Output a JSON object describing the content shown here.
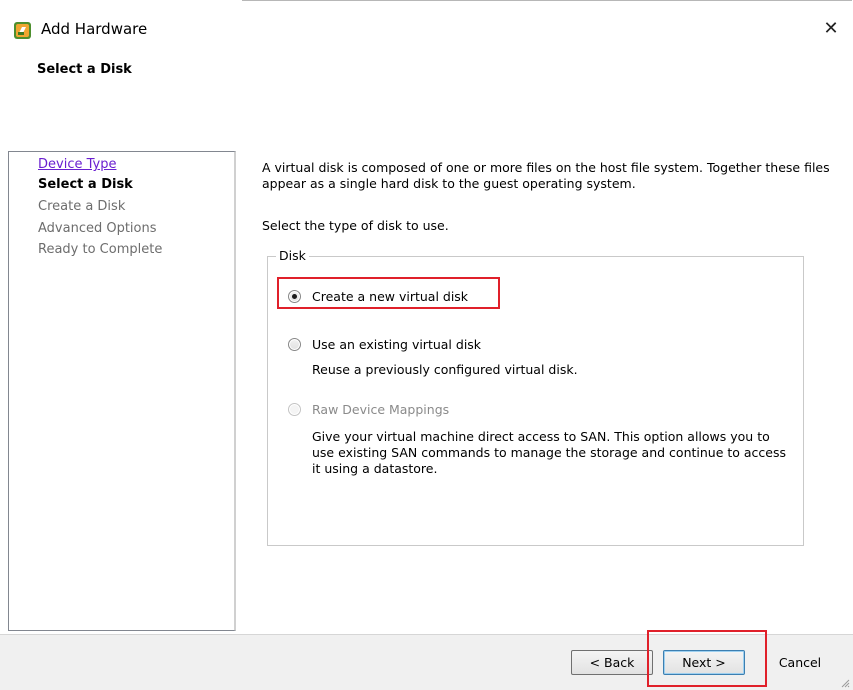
{
  "window": {
    "title": "Add Hardware",
    "close_symbol": "✕",
    "subtitle": "Select a Disk"
  },
  "nav": {
    "items": [
      {
        "label": "Device Type",
        "state": "link"
      },
      {
        "label": "Select a Disk",
        "state": "current"
      },
      {
        "label": "Create a Disk",
        "state": "disabled"
      },
      {
        "label": "Advanced Options",
        "state": "disabled"
      },
      {
        "label": "Ready to Complete",
        "state": "disabled"
      }
    ]
  },
  "main": {
    "description": "A virtual disk is composed of one or more files on the host file system. Together these files appear as a single hard disk to the guest operating system.",
    "prompt": "Select the type of disk to use.",
    "group_label": "Disk",
    "options": [
      {
        "label": "Create a new virtual disk",
        "checked": true,
        "enabled": true,
        "description": ""
      },
      {
        "label": "Use an existing virtual disk",
        "checked": false,
        "enabled": true,
        "description": "Reuse a previously configured virtual disk."
      },
      {
        "label": "Raw Device Mappings",
        "checked": false,
        "enabled": false,
        "description": "Give your virtual machine direct access to SAN. This option allows you to use existing SAN commands to manage the storage and continue to access it using a datastore."
      }
    ]
  },
  "buttons": {
    "back": "< Back",
    "next": "Next >",
    "cancel": "Cancel"
  },
  "colors": {
    "highlight": "#e0202a",
    "link": "#6a1fd0"
  },
  "icons": {
    "app": "vsphere-app-icon",
    "close": "close-icon"
  }
}
